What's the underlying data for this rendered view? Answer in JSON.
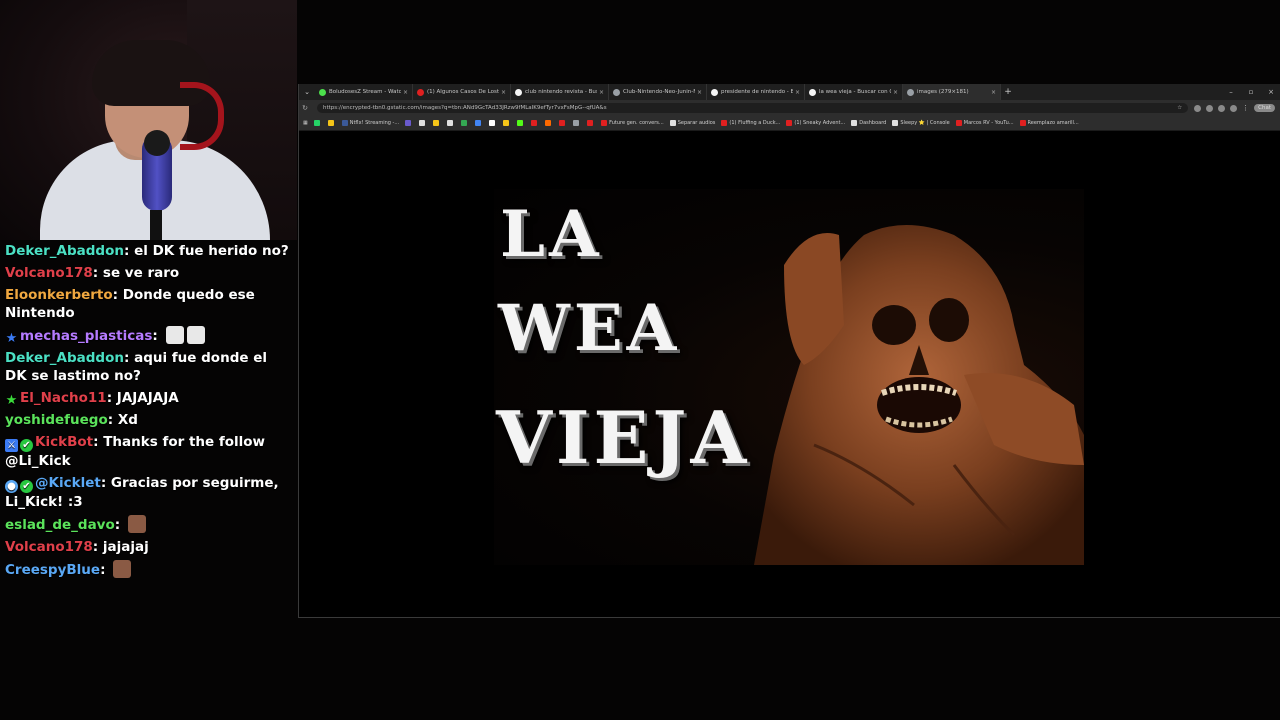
{
  "chat": {
    "messages": [
      {
        "user": "Deker_Abaddon",
        "color": "#4be0c4",
        "text": "el DK fue herido no?"
      },
      {
        "user": "Volcano178",
        "color": "#e0404a",
        "text": "se ve raro"
      },
      {
        "user": "Eloonkerberto",
        "color": "#f0a840",
        "text": "Donde quedo ese Nintendo"
      },
      {
        "user": "mechas_plasticas",
        "color": "#b57bff",
        "text": "",
        "badge": "star",
        "badge_color": "#3b7bf5",
        "emotes": 2
      },
      {
        "user": "Deker_Abaddon",
        "color": "#4be0c4",
        "text": "aqui fue donde el DK se lastimo no?"
      },
      {
        "user": "El_Nacho11",
        "color": "#e0404a",
        "text": "JAJAJAJA",
        "badge": "star",
        "badge_color": "#3bdb3b"
      },
      {
        "user": "yoshidefuego",
        "color": "#5be35b",
        "text": "Xd"
      },
      {
        "user": "KickBot",
        "color": "#e0404a",
        "text": "Thanks for the follow @Li_Kick",
        "badges": [
          "sword",
          "check"
        ]
      },
      {
        "user": "@Kicklet",
        "color": "#5aa8f5",
        "text": "Gracias por seguirme, Li_Kick! :3",
        "badges": [
          "bot",
          "check"
        ]
      },
      {
        "user": "eslad_de_davo",
        "color": "#5be35b",
        "text": "",
        "emote_single": true
      },
      {
        "user": "Volcano178",
        "color": "#e0404a",
        "text": "jajajaj"
      },
      {
        "user": "CreespyBlue",
        "color": "#5aa8f5",
        "text": "",
        "emote_single": true
      }
    ]
  },
  "browser": {
    "tabs": [
      {
        "title": "BoludosesZ Stream - Watch Live o",
        "icon_color": "#4ce04c"
      },
      {
        "title": "(1) Algunos Casos De Lost Media",
        "icon_color": "#e02020"
      },
      {
        "title": "club nintendo revista - Buscar con",
        "icon_color": "#f5f5f5"
      },
      {
        "title": "Club-Nintendo-Neo-Junin-Facebo",
        "icon_color": "#9aa0a6"
      },
      {
        "title": "presidente de nintendo - Buscar c",
        "icon_color": "#f5f5f5"
      },
      {
        "title": "la wea vieja - Buscar con Google",
        "icon_color": "#f5f5f5"
      },
      {
        "title": "images (279×181)",
        "icon_color": "#9aa0a6",
        "active": true
      }
    ],
    "url": "https://encrypted-tbn0.gstatic.com/images?q=tbn:ANd9GcTAd33JRzw9fMLaIK9efTyr7vxFsMpG--qfUA&s",
    "chat_button": "Chat",
    "bookmarks": [
      {
        "label": "",
        "color": "#25d366"
      },
      {
        "label": "",
        "color": "#f5c518"
      },
      {
        "label": "Ntflx! Streaming -...",
        "color": "#3b5998"
      },
      {
        "label": "",
        "color": "#6a5acd"
      },
      {
        "label": "",
        "color": "#e0e0e0"
      },
      {
        "label": "",
        "color": "#f5c518"
      },
      {
        "label": "",
        "color": "#e0e0e0"
      },
      {
        "label": "",
        "color": "#34a853"
      },
      {
        "label": "",
        "color": "#4285f4"
      },
      {
        "label": "",
        "color": "#ffffff"
      },
      {
        "label": "",
        "color": "#f5c518"
      },
      {
        "label": "",
        "color": "#53fc18"
      },
      {
        "label": "",
        "color": "#e02020"
      },
      {
        "label": "",
        "color": "#ff6a00"
      },
      {
        "label": "",
        "color": "#e02020"
      },
      {
        "label": "",
        "color": "#9aa0a6"
      },
      {
        "label": "",
        "color": "#e02020"
      },
      {
        "label": "Future gen. convers...",
        "color": "#e02020"
      },
      {
        "label": "Separar audios",
        "color": "#e0e0e0"
      },
      {
        "label": "(1) Fluffing a Duck...",
        "color": "#e02020"
      },
      {
        "label": "(1) Sneaky Advent...",
        "color": "#e02020"
      },
      {
        "label": "Dashboard",
        "color": "#e0e0e0"
      },
      {
        "label": "Sleepy ⭐ | Console",
        "color": "#e0e0e0"
      },
      {
        "label": "Marcos RV - YouTu...",
        "color": "#e02020"
      },
      {
        "label": "Reemplazo amarill...",
        "color": "#e02020"
      }
    ]
  },
  "meme": {
    "line1": "LA",
    "line2": "WEA",
    "line3": "VIEJA"
  }
}
